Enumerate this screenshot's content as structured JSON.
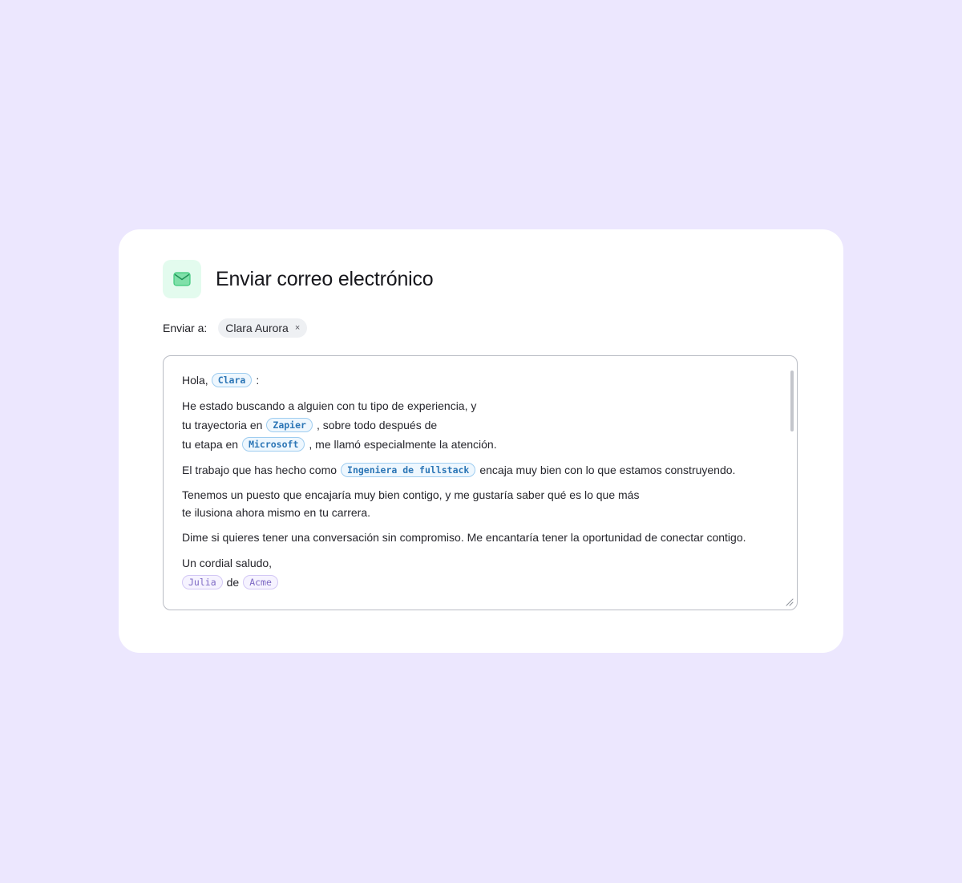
{
  "dialog": {
    "title": "Enviar correo electrónico",
    "icon": "mail-icon",
    "accent_color": "#3ec97c"
  },
  "recipient": {
    "label": "Enviar a:",
    "chip": "Clara Aurora",
    "remove": "×"
  },
  "message": {
    "greeting_prefix": "Hola,",
    "greeting_var": "Clara",
    "greeting_suffix": ":",
    "p1_l1": "He estado buscando a alguien con tu tipo de experiencia, y",
    "p1_l2_prefix": "tu trayectoria en",
    "p1_l2_var": "Zapier",
    "p1_l2_suffix": ", sobre todo después de",
    "p1_l3_prefix": "tu etapa en",
    "p1_l3_var": "Microsoft",
    "p1_l3_suffix": ", me llamó especialmente la atención.",
    "p2_prefix": "El trabajo que has hecho como",
    "p2_var": "Ingeniera de fullstack",
    "p2_suffix": "encaja muy bien con lo que estamos construyendo.",
    "p3_l1": "Tenemos un puesto que encajaría muy bien contigo, y me gustaría saber qué es lo que más",
    "p3_l2": "te ilusiona ahora mismo en tu carrera.",
    "p4": "Dime si quieres tener una conversación sin compromiso. Me encantaría tener la oportunidad de conectar contigo.",
    "closing": "Un cordial saludo,",
    "sig_var_name": "Julia",
    "sig_mid": "de",
    "sig_var_company": "Acme"
  }
}
